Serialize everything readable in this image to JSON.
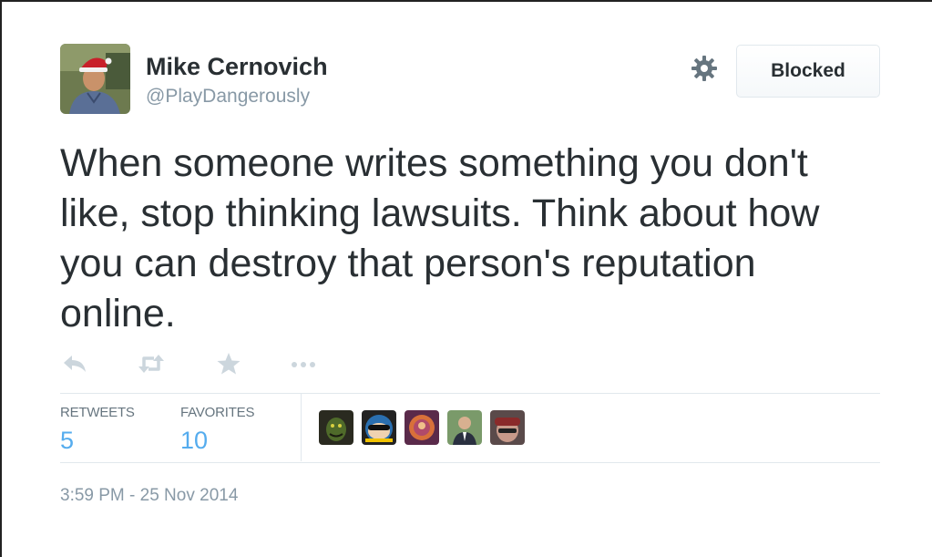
{
  "author": {
    "name": "Mike Cernovich",
    "handle": "@PlayDangerously",
    "avatar_icon": "profile-photo-santa-hat"
  },
  "header": {
    "settings_icon": "gear-icon",
    "follow_state_label": "Blocked"
  },
  "tweet": {
    "text": "When someone writes something you don't like, stop thinking lawsuits. Think about how you can destroy that person's reputation online."
  },
  "actions": [
    {
      "icon": "reply-icon"
    },
    {
      "icon": "retweet-icon"
    },
    {
      "icon": "star-icon"
    },
    {
      "icon": "more-icon"
    }
  ],
  "stats": {
    "retweets_label": "RETWEETS",
    "retweets_value": "5",
    "favorites_label": "FAVORITES",
    "favorites_value": "10"
  },
  "favoriters": [
    {
      "icon": "favoriter-avatar-1",
      "color": "#3a4a2a"
    },
    {
      "icon": "favoriter-avatar-2",
      "color": "#2a6fb0"
    },
    {
      "icon": "favoriter-avatar-3",
      "color": "#b0503a"
    },
    {
      "icon": "favoriter-avatar-4",
      "color": "#6a8a5a"
    },
    {
      "icon": "favoriter-avatar-5",
      "color": "#8a3a3a"
    }
  ],
  "timestamp": "3:59 PM - 25 Nov 2014",
  "colors": {
    "text": "#292f33",
    "muted": "#8899a6",
    "accent": "#55acee",
    "action_icon": "#ccd6dd"
  }
}
